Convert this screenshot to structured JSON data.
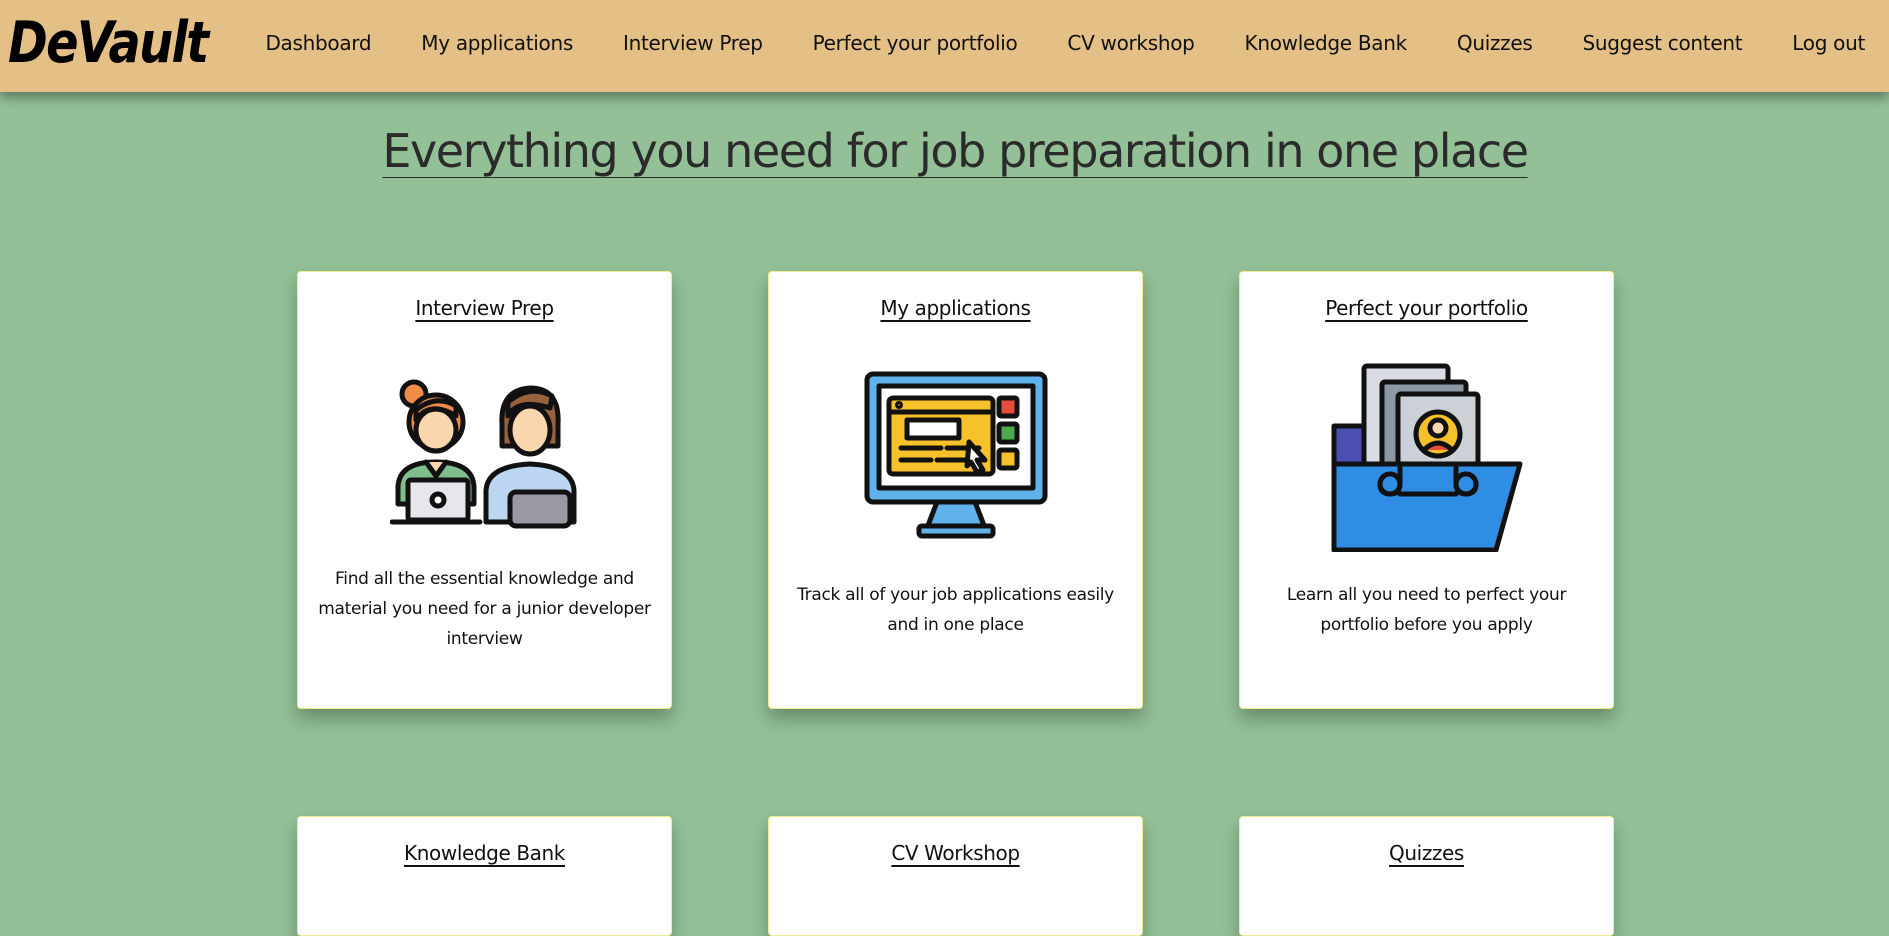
{
  "brand": {
    "logo_text": "DeVault"
  },
  "nav": {
    "links": [
      "Dashboard",
      "My applications",
      "Interview Prep",
      "Perfect your portfolio",
      "CV workshop",
      "Knowledge Bank",
      "Quizzes",
      "Suggest content",
      "Log out"
    ]
  },
  "hero": {
    "title": "Everything you need for job preparation in one place"
  },
  "cards": [
    {
      "title": "Interview Prep",
      "icon": "interview-icon",
      "description": "Find all the essential knowledge and material you need for a junior developer interview"
    },
    {
      "title": "My applications",
      "icon": "monitor-application-icon",
      "description": "Track all of your job applications easily and in one place"
    },
    {
      "title": "Perfect your portfolio",
      "icon": "portfolio-folder-icon",
      "description": "Learn all you need to perfect your portfolio before you apply"
    },
    {
      "title": "Knowledge Bank",
      "icon": "",
      "description": ""
    },
    {
      "title": "CV Workshop",
      "icon": "",
      "description": ""
    },
    {
      "title": "Quizzes",
      "icon": "",
      "description": ""
    }
  ],
  "colors": {
    "navbar": "#e4bf86",
    "background": "#93c096",
    "card": "#ffffff",
    "card_border": "#f1ec8d"
  }
}
